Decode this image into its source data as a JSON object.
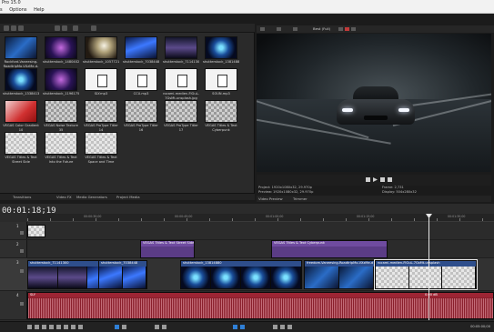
{
  "app": {
    "title": "Pro 15.0"
  },
  "menu": [
    "s",
    "Options",
    "Help"
  ],
  "explorer": {
    "tiles": [
      {
        "cap": "Rockford-Vaneesing-RoadtripMo-VXzMe-d-medium.jpg",
        "thumb": "t-blue1"
      },
      {
        "cap": "shutterstock_1480402050.jpg",
        "thumb": "t-purple"
      },
      {
        "cap": "shutterstock_1057721053.jpg",
        "thumb": "t-light"
      },
      {
        "cap": "shutterstock_70384480.jpg",
        "thumb": "t-wave"
      },
      {
        "cap": "shutterstock_71141300.jpg",
        "thumb": "t-city"
      },
      {
        "cap": "shutterstock_13814880.jpg",
        "thumb": "t-portal"
      },
      {
        "cap": "shutterstock_1338413502.jpg",
        "thumb": "t-portal"
      },
      {
        "cap": "shutterstock_11961750.jpg",
        "thumb": "t-purple"
      },
      {
        "cap": "SLY.mp3",
        "thumb": "t-doc"
      },
      {
        "cap": "CCU.mp3",
        "thumb": "t-doc"
      },
      {
        "cap": "rocami-medien-FlGuL-7GsMt-unsplash.jpg",
        "thumb": "t-doc"
      },
      {
        "cap": "SOUN.mp3",
        "thumb": "t-doc"
      },
      {
        "cap": "VEGAS Color Gradient 10",
        "thumb": "t-red"
      },
      {
        "cap": "VEGAS Noise Texture 35",
        "thumb": "t-check"
      },
      {
        "cap": "VEGAS ProType Titler 14",
        "thumb": "t-check"
      },
      {
        "cap": "VEGAS ProType Titler 16",
        "thumb": "t-check"
      },
      {
        "cap": "VEGAS ProType Titler 17",
        "thumb": "t-check"
      },
      {
        "cap": "VEGAS Titles & Text Cyberpunk",
        "thumb": "t-check"
      },
      {
        "cap": "VEGAS Titles & Text Street Side",
        "thumb": "t-checkw"
      },
      {
        "cap": "VEGAS Titles & Text Into the Future",
        "thumb": "t-checkw"
      },
      {
        "cap": "VEGAS Titles & Text Space and Time",
        "thumb": "t-checkw"
      }
    ],
    "tabs": [
      "Transitions",
      "Video FX",
      "Media Generators",
      "Project Media"
    ]
  },
  "preview": {
    "toolbar_label": "Best (Full)",
    "info": {
      "project": "Project: 1920x1080x32, 29.970p",
      "preview": "Preview: 1920x1080x32, 29.970p",
      "frame": "Frame: 2,731",
      "display": "Display: 504x280x32"
    },
    "tabs": [
      "Video Preview",
      "Trimmer"
    ]
  },
  "timeline": {
    "timecode": "00:01:18;19",
    "ruler_ticks": [
      "00:00:30;00",
      "00:00:45;00",
      "00:01:00;00",
      "00:01:15;00",
      "00:01:30;00"
    ],
    "tracks": [
      {
        "num": "1"
      },
      {
        "num": "2"
      },
      {
        "num": "3"
      },
      {
        "num": "4"
      }
    ],
    "title_clips": [
      {
        "label": "VEGAS Titles & Text Street Side"
      },
      {
        "label": "VEGAS Titles & Text Cyberpunk"
      }
    ],
    "video_clips": [
      {
        "label": "shutterstock_71141300"
      },
      {
        "label": "shutterstock_7038448"
      },
      {
        "label": "shutterstock_13814880"
      },
      {
        "label": "freedom-Vaneesing-RoadtripMo-VXzMe-d"
      },
      {
        "label": "rocami-medien-FlGuL-7GsMt-unsplash"
      }
    ],
    "audio_clips": [
      {
        "label": "SLY"
      }
    ],
    "audio_level": "0.00 dB",
    "end_time": "00:05:00;00"
  },
  "colors": {
    "video_clip": "#2e4e8c",
    "title_clip": "#5b3c86",
    "audio_clip": "#8a1f2c",
    "accent": "#2f7fd6"
  }
}
